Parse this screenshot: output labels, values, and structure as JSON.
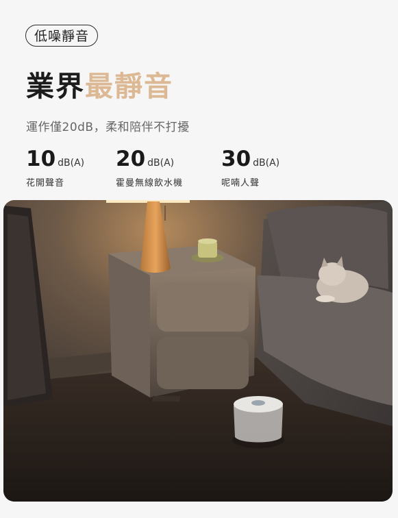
{
  "badge": "低噪靜音",
  "headline": {
    "main": "業界",
    "accent": "最靜音"
  },
  "subtitle": "運作僅20dB，柔和陪伴不打擾",
  "stats": [
    {
      "value": "10",
      "unit": "dB(A)",
      "label": "花開聲音"
    },
    {
      "value": "20",
      "unit": "dB(A)",
      "label": "霍曼無線飲水機"
    },
    {
      "value": "30",
      "unit": "dB(A)",
      "label": "呢喃人聲"
    }
  ],
  "colors": {
    "accent": "#dcb994",
    "text": "#1c1c1c",
    "background": "#f6f6f6"
  },
  "photo": {
    "alt": "夜間臥室床頭櫃旁的寵物飲水機與貓"
  }
}
